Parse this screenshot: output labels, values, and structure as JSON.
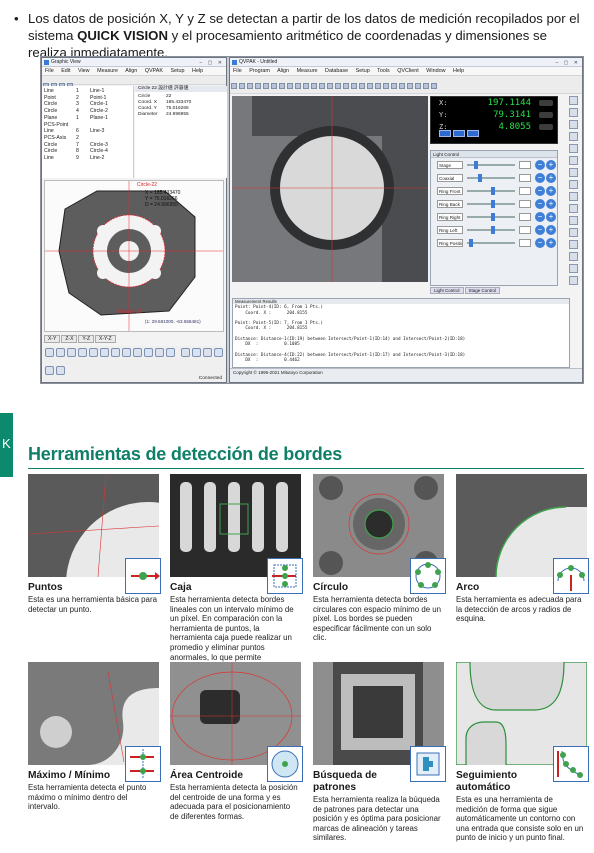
{
  "intro": {
    "bullet": "•",
    "text_a": "Los datos de posición X, Y y Z se detectan a partir de los datos de medición recopilados por el sistema",
    "text_bold": "QUICK VISION",
    "text_b": "y el procesamiento aritmético de coordenadas y dimensiones se realiza inmediatamente."
  },
  "graphic_view": {
    "title": "Graphic View",
    "menu": [
      "File",
      "Edit",
      "View",
      "Measure",
      "Align",
      "QVPAK",
      "Setup",
      "Help"
    ],
    "list": [
      {
        "name": "Line",
        "n": "1",
        "ref": "Line-1"
      },
      {
        "name": "Point",
        "n": "2",
        "ref": "Point-1"
      },
      {
        "name": "Circle",
        "n": "3",
        "ref": "Circle-1"
      },
      {
        "name": "Circle",
        "n": "4",
        "ref": "Circle-2"
      },
      {
        "name": "Plane",
        "n": "1",
        "ref": "Plane-1"
      },
      {
        "name": "PCS-Point",
        "n": "",
        "ref": ""
      },
      {
        "name": "Line",
        "n": "6",
        "ref": "Line-3"
      },
      {
        "name": "PCS-Axis",
        "n": "2",
        "ref": ""
      },
      {
        "name": "Circle",
        "n": "7",
        "ref": "Circle-3"
      },
      {
        "name": "Circle",
        "n": "8",
        "ref": "Circle-4"
      },
      {
        "name": "Line",
        "n": "9",
        "ref": "Line-2"
      }
    ],
    "detail_header": "Circle   22      設計値    許容値",
    "detail_rows": [
      {
        "k": "Circle",
        "v": "22"
      },
      {
        "k": "Coord. X",
        "v": "185.433470"
      },
      {
        "k": "Coord. Y",
        "v": "75.016266"
      },
      {
        "k": "Diameter",
        "v": "24.996955"
      }
    ],
    "graph_label": "Circle-22",
    "graph_readout": [
      "X = 185.433470",
      "Y = 75.016266",
      "D = 24.996955"
    ],
    "graph_distance": "Distance-22",
    "graph_coords": "(1: 29.681000, -63.558481)",
    "tabs": [
      "X-Y",
      "Z-X",
      "Y-Z",
      "X-Y-Z"
    ],
    "status": "Connected"
  },
  "qvpak": {
    "title": "QVPAK - Untitled",
    "menu": [
      "File",
      "Program",
      "Align",
      "Measure",
      "Database",
      "Setup",
      "Tools",
      "QVClient",
      "Window",
      "Help"
    ],
    "dro": [
      {
        "axis": "X:",
        "value": "197.1144"
      },
      {
        "axis": "Y:",
        "value": "79.3141"
      },
      {
        "axis": "Z:",
        "value": "4.8055"
      }
    ],
    "light_title": "Light Control",
    "lights": [
      {
        "label": "Stage",
        "level": 0.15
      },
      {
        "label": "Coaxial",
        "level": 0.25
      },
      {
        "label": "Ring Front",
        "level": 0.55
      },
      {
        "label": "Ring Back",
        "level": 0.55
      },
      {
        "label": "Ring Right",
        "level": 0.55
      },
      {
        "label": "Ring Left",
        "level": 0.55
      },
      {
        "label": "Ring Position",
        "level": 0.05
      }
    ],
    "light_tabs": [
      "Light Control",
      "Stage Control"
    ],
    "results_header": "Measurement Results",
    "results_text": "Point: Point-4(ID: 6, From 1 Pts.)\n    Coord. X :      204.8155\n\nPoint: Point-5(ID: 7, From 1 Pts.)\n    Coord. X :      204.8155\n\nDistance: Distance-1(ID:19) between Intersect/Point-1(ID:14) and Intersect/Point-2(ID:18)\n    DX  :          0.1085\n\nDistance: Distance-4(ID:22) between Intersect/Point-1(ID:17) and Intersect/Point-3(ID:18)\n    DX  :          0.4462\n\nDistance: Distance-5(ID:23) between Intersect/Point-4(ID:15) and Intersect/Point-5(ID:16)\n    DX  :          0.1085",
    "footer": "Copyright © 1995-2021 Mitutoyo Corporation"
  },
  "side_tab": "K",
  "section_title": "Herramientas de detección de bordes",
  "tools": [
    {
      "name": "Puntos",
      "desc": "Esta es una herramienta básica para detectar un punto."
    },
    {
      "name": "Caja",
      "desc": "Esta herramienta detecta bordes lineales con un intervalo mínimo de un píxel. En comparación con la herramienta de puntos, la herramienta caja puede realizar un promedio y eliminar puntos anormales, lo que permite mediciones estables."
    },
    {
      "name": "Círculo",
      "desc": "Esta herramienta detecta bordes circulares con espacio mínimo de un píxel. Los bordes se pueden especificar fácilmente con un solo clic."
    },
    {
      "name": "Arco",
      "desc": "Esta herramienta es adecuada para la detección de arcos y radios de esquina."
    },
    {
      "name": "Máximo / Mínimo",
      "desc": "Esta herramienta detecta el punto máximo o mínimo dentro del intervalo."
    },
    {
      "name": "Área Centroide",
      "desc": "Esta herramienta detecta la posición del centroide de una forma y es adecuada para el posicionamiento de diferentes formas."
    },
    {
      "name": "Búsqueda de patrones",
      "desc": "Esta herramienta realiza la búqueda de patrones para detectar una posición y es óptima para posicionar marcas de alineación y tareas similares."
    },
    {
      "name": "Seguimiento automático",
      "desc": "Esta es una herramienta de medición de forma que sigue automáticamente un contorno con una entrada que consiste solo en un punto de inicio y un punto final."
    }
  ],
  "colors": {
    "accent": "#0f7f67",
    "dro_digits": "#27e04a",
    "tool_badge_border": "#3a6fb8"
  }
}
